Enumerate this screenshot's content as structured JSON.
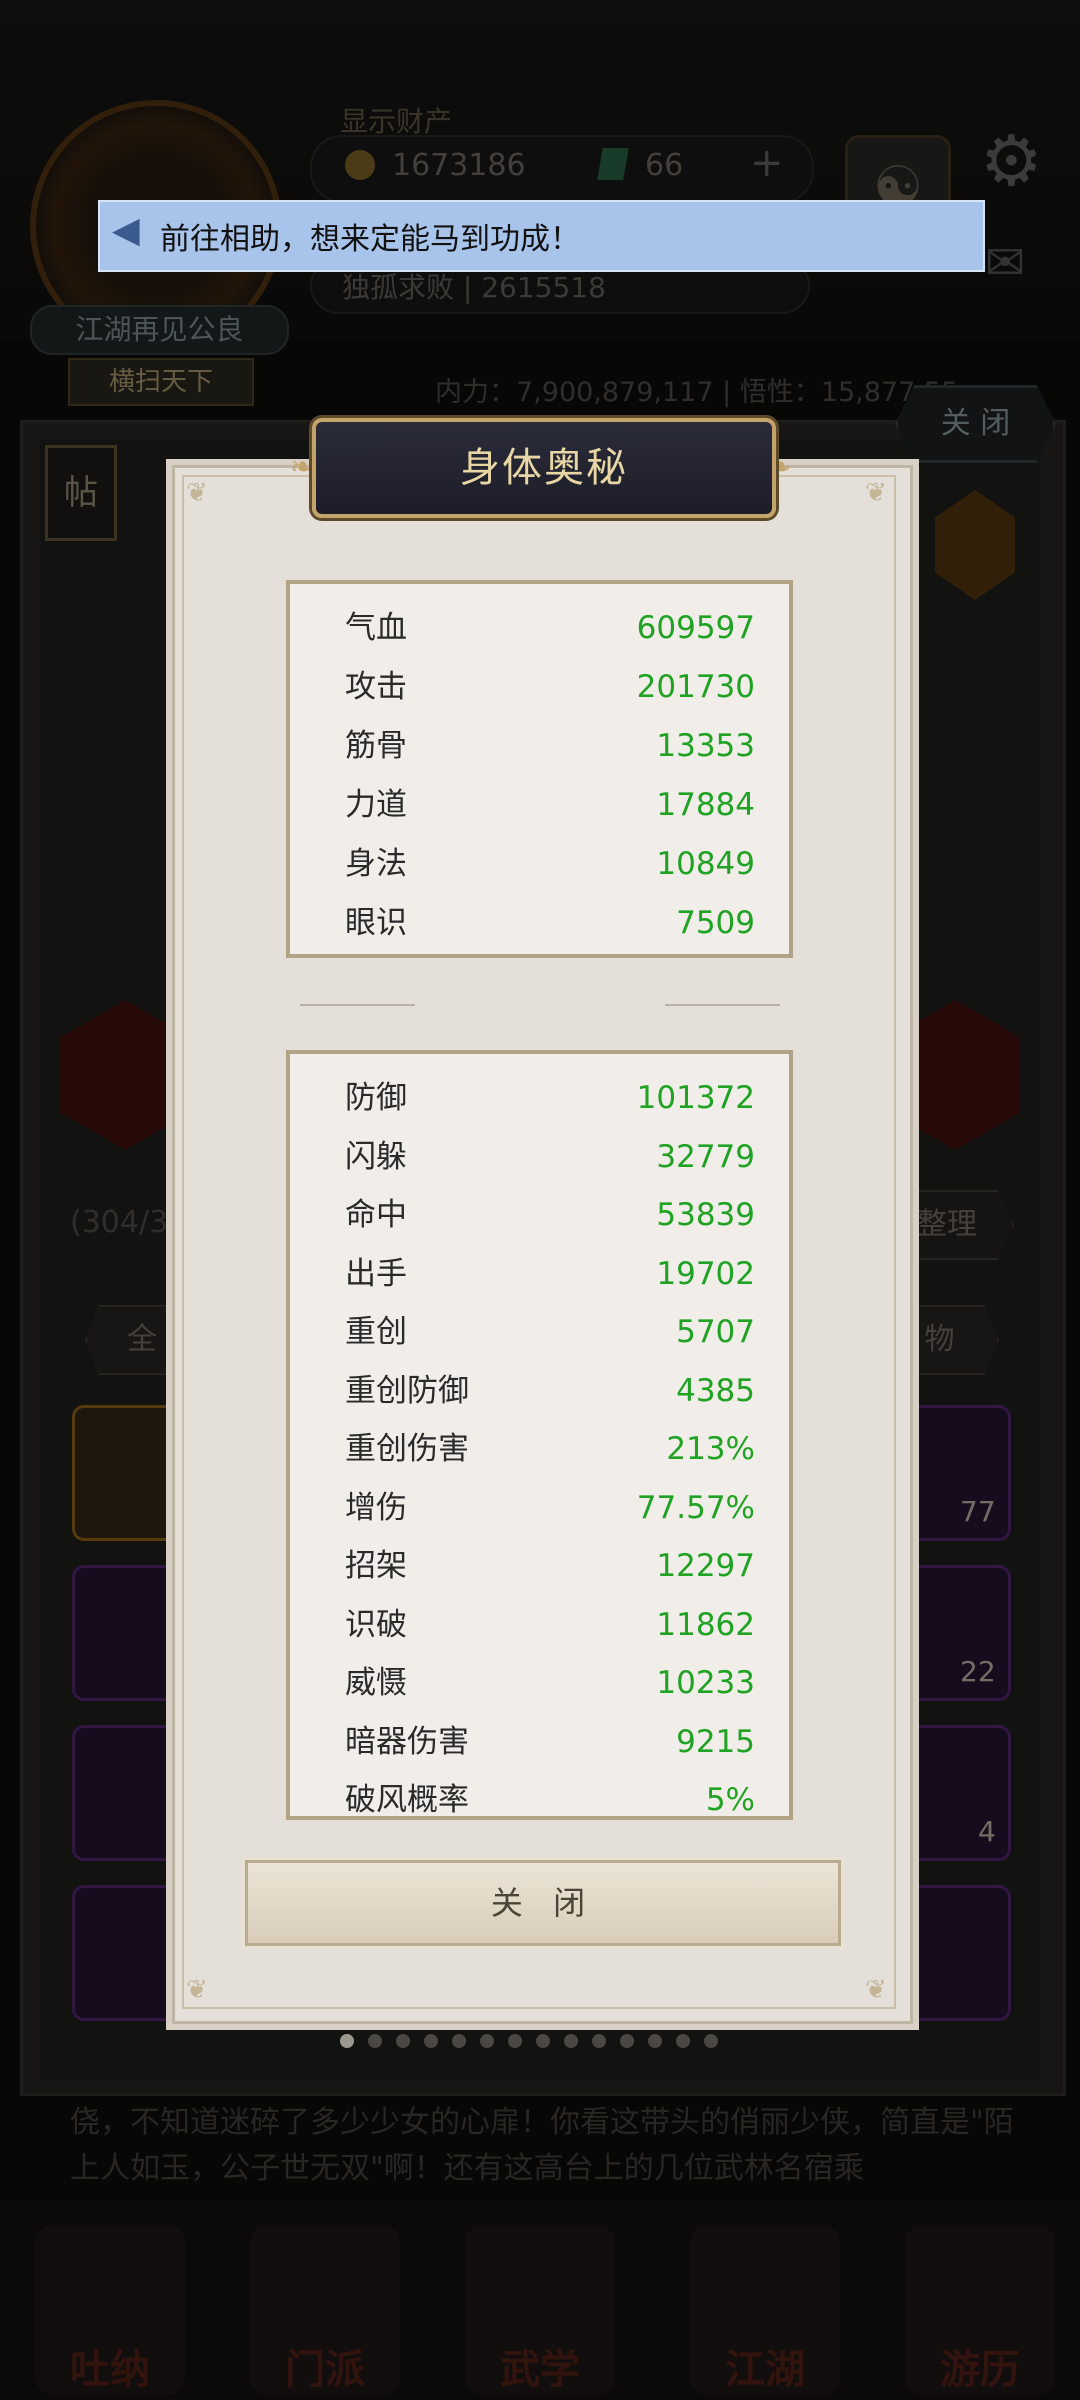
{
  "background": {
    "wealth_label": "显示财产",
    "coins": "1673186",
    "jade": "66",
    "plus": "+",
    "yinyang": "☯",
    "player_name": "江湖再见公良",
    "player_title": "横扫天下",
    "rank_text": "独孤求败 | 2615518",
    "power_line": "内力：7,900,879,117 | 悟性：15,877,55…",
    "close_top": "关 闭",
    "tie_label": "帖",
    "count_text": "(304/3…",
    "sort_label": "整理",
    "tab_all": "全",
    "tab_item": "物",
    "slot_counts": [
      "77",
      "22",
      "4"
    ],
    "story_text": "侥，不知道迷碎了多少少女的心扉！你看这带头的俏丽少侠，简直是\"陌上人如玉，公子世无双\"啊！还有这高台上的几位武林名宿乘",
    "nav": [
      "吐纳",
      "门派",
      "武学",
      "江湖",
      "游历"
    ]
  },
  "notice": {
    "text": "前往相助，想来定能马到功成！"
  },
  "modal": {
    "title": "身体奥秘",
    "basic_stats": [
      {
        "name": "气血",
        "value": "609597"
      },
      {
        "name": "攻击",
        "value": "201730"
      },
      {
        "name": "筋骨",
        "value": "13353"
      },
      {
        "name": "力道",
        "value": "17884"
      },
      {
        "name": "身法",
        "value": "10849"
      },
      {
        "name": "眼识",
        "value": "7509"
      }
    ],
    "combat_stats": [
      {
        "name": "防御",
        "value": "101372"
      },
      {
        "name": "闪躲",
        "value": "32779"
      },
      {
        "name": "命中",
        "value": "53839"
      },
      {
        "name": "出手",
        "value": "19702"
      },
      {
        "name": "重创",
        "value": "5707"
      },
      {
        "name": "重创防御",
        "value": "4385"
      },
      {
        "name": "重创伤害",
        "value": "213%"
      },
      {
        "name": "增伤",
        "value": "77.57%"
      },
      {
        "name": "招架",
        "value": "12297"
      },
      {
        "name": "识破",
        "value": "11862"
      },
      {
        "name": "威慑",
        "value": "10233"
      },
      {
        "name": "暗器伤害",
        "value": "9215"
      },
      {
        "name": "破风概率",
        "value": "5%"
      }
    ],
    "close_label": "关 闭"
  },
  "pager": {
    "total": 14,
    "active": 0
  },
  "colors": {
    "stat_value": "#20a223",
    "title_text": "#e8d6a4",
    "notice_bg": "#a9c4ea"
  }
}
